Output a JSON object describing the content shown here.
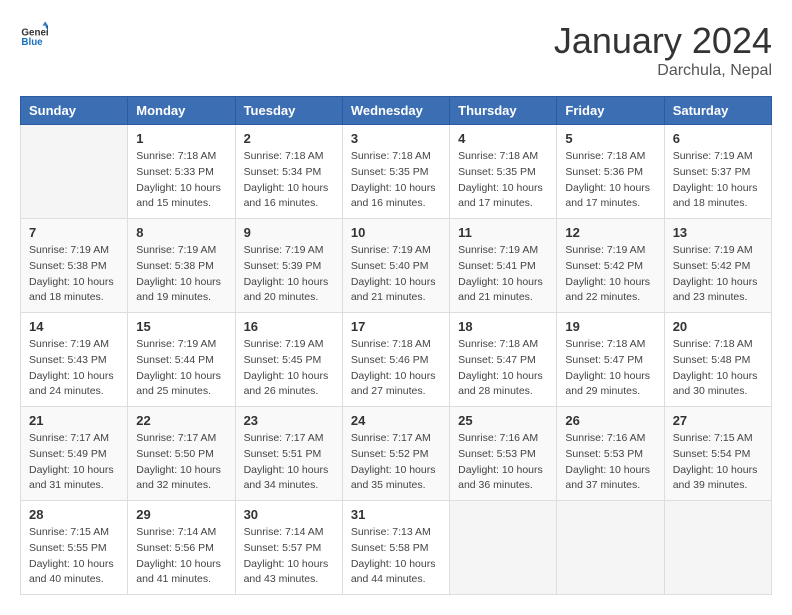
{
  "header": {
    "logo_general": "General",
    "logo_blue": "Blue",
    "month_title": "January 2024",
    "location": "Darchula, Nepal"
  },
  "columns": [
    "Sunday",
    "Monday",
    "Tuesday",
    "Wednesday",
    "Thursday",
    "Friday",
    "Saturday"
  ],
  "weeks": [
    [
      {
        "day": "",
        "info": ""
      },
      {
        "day": "1",
        "info": "Sunrise: 7:18 AM\nSunset: 5:33 PM\nDaylight: 10 hours\nand 15 minutes."
      },
      {
        "day": "2",
        "info": "Sunrise: 7:18 AM\nSunset: 5:34 PM\nDaylight: 10 hours\nand 16 minutes."
      },
      {
        "day": "3",
        "info": "Sunrise: 7:18 AM\nSunset: 5:35 PM\nDaylight: 10 hours\nand 16 minutes."
      },
      {
        "day": "4",
        "info": "Sunrise: 7:18 AM\nSunset: 5:35 PM\nDaylight: 10 hours\nand 17 minutes."
      },
      {
        "day": "5",
        "info": "Sunrise: 7:18 AM\nSunset: 5:36 PM\nDaylight: 10 hours\nand 17 minutes."
      },
      {
        "day": "6",
        "info": "Sunrise: 7:19 AM\nSunset: 5:37 PM\nDaylight: 10 hours\nand 18 minutes."
      }
    ],
    [
      {
        "day": "7",
        "info": "Sunrise: 7:19 AM\nSunset: 5:38 PM\nDaylight: 10 hours\nand 18 minutes."
      },
      {
        "day": "8",
        "info": "Sunrise: 7:19 AM\nSunset: 5:38 PM\nDaylight: 10 hours\nand 19 minutes."
      },
      {
        "day": "9",
        "info": "Sunrise: 7:19 AM\nSunset: 5:39 PM\nDaylight: 10 hours\nand 20 minutes."
      },
      {
        "day": "10",
        "info": "Sunrise: 7:19 AM\nSunset: 5:40 PM\nDaylight: 10 hours\nand 21 minutes."
      },
      {
        "day": "11",
        "info": "Sunrise: 7:19 AM\nSunset: 5:41 PM\nDaylight: 10 hours\nand 21 minutes."
      },
      {
        "day": "12",
        "info": "Sunrise: 7:19 AM\nSunset: 5:42 PM\nDaylight: 10 hours\nand 22 minutes."
      },
      {
        "day": "13",
        "info": "Sunrise: 7:19 AM\nSunset: 5:42 PM\nDaylight: 10 hours\nand 23 minutes."
      }
    ],
    [
      {
        "day": "14",
        "info": "Sunrise: 7:19 AM\nSunset: 5:43 PM\nDaylight: 10 hours\nand 24 minutes."
      },
      {
        "day": "15",
        "info": "Sunrise: 7:19 AM\nSunset: 5:44 PM\nDaylight: 10 hours\nand 25 minutes."
      },
      {
        "day": "16",
        "info": "Sunrise: 7:19 AM\nSunset: 5:45 PM\nDaylight: 10 hours\nand 26 minutes."
      },
      {
        "day": "17",
        "info": "Sunrise: 7:18 AM\nSunset: 5:46 PM\nDaylight: 10 hours\nand 27 minutes."
      },
      {
        "day": "18",
        "info": "Sunrise: 7:18 AM\nSunset: 5:47 PM\nDaylight: 10 hours\nand 28 minutes."
      },
      {
        "day": "19",
        "info": "Sunrise: 7:18 AM\nSunset: 5:47 PM\nDaylight: 10 hours\nand 29 minutes."
      },
      {
        "day": "20",
        "info": "Sunrise: 7:18 AM\nSunset: 5:48 PM\nDaylight: 10 hours\nand 30 minutes."
      }
    ],
    [
      {
        "day": "21",
        "info": "Sunrise: 7:17 AM\nSunset: 5:49 PM\nDaylight: 10 hours\nand 31 minutes."
      },
      {
        "day": "22",
        "info": "Sunrise: 7:17 AM\nSunset: 5:50 PM\nDaylight: 10 hours\nand 32 minutes."
      },
      {
        "day": "23",
        "info": "Sunrise: 7:17 AM\nSunset: 5:51 PM\nDaylight: 10 hours\nand 34 minutes."
      },
      {
        "day": "24",
        "info": "Sunrise: 7:17 AM\nSunset: 5:52 PM\nDaylight: 10 hours\nand 35 minutes."
      },
      {
        "day": "25",
        "info": "Sunrise: 7:16 AM\nSunset: 5:53 PM\nDaylight: 10 hours\nand 36 minutes."
      },
      {
        "day": "26",
        "info": "Sunrise: 7:16 AM\nSunset: 5:53 PM\nDaylight: 10 hours\nand 37 minutes."
      },
      {
        "day": "27",
        "info": "Sunrise: 7:15 AM\nSunset: 5:54 PM\nDaylight: 10 hours\nand 39 minutes."
      }
    ],
    [
      {
        "day": "28",
        "info": "Sunrise: 7:15 AM\nSunset: 5:55 PM\nDaylight: 10 hours\nand 40 minutes."
      },
      {
        "day": "29",
        "info": "Sunrise: 7:14 AM\nSunset: 5:56 PM\nDaylight: 10 hours\nand 41 minutes."
      },
      {
        "day": "30",
        "info": "Sunrise: 7:14 AM\nSunset: 5:57 PM\nDaylight: 10 hours\nand 43 minutes."
      },
      {
        "day": "31",
        "info": "Sunrise: 7:13 AM\nSunset: 5:58 PM\nDaylight: 10 hours\nand 44 minutes."
      },
      {
        "day": "",
        "info": ""
      },
      {
        "day": "",
        "info": ""
      },
      {
        "day": "",
        "info": ""
      }
    ]
  ]
}
